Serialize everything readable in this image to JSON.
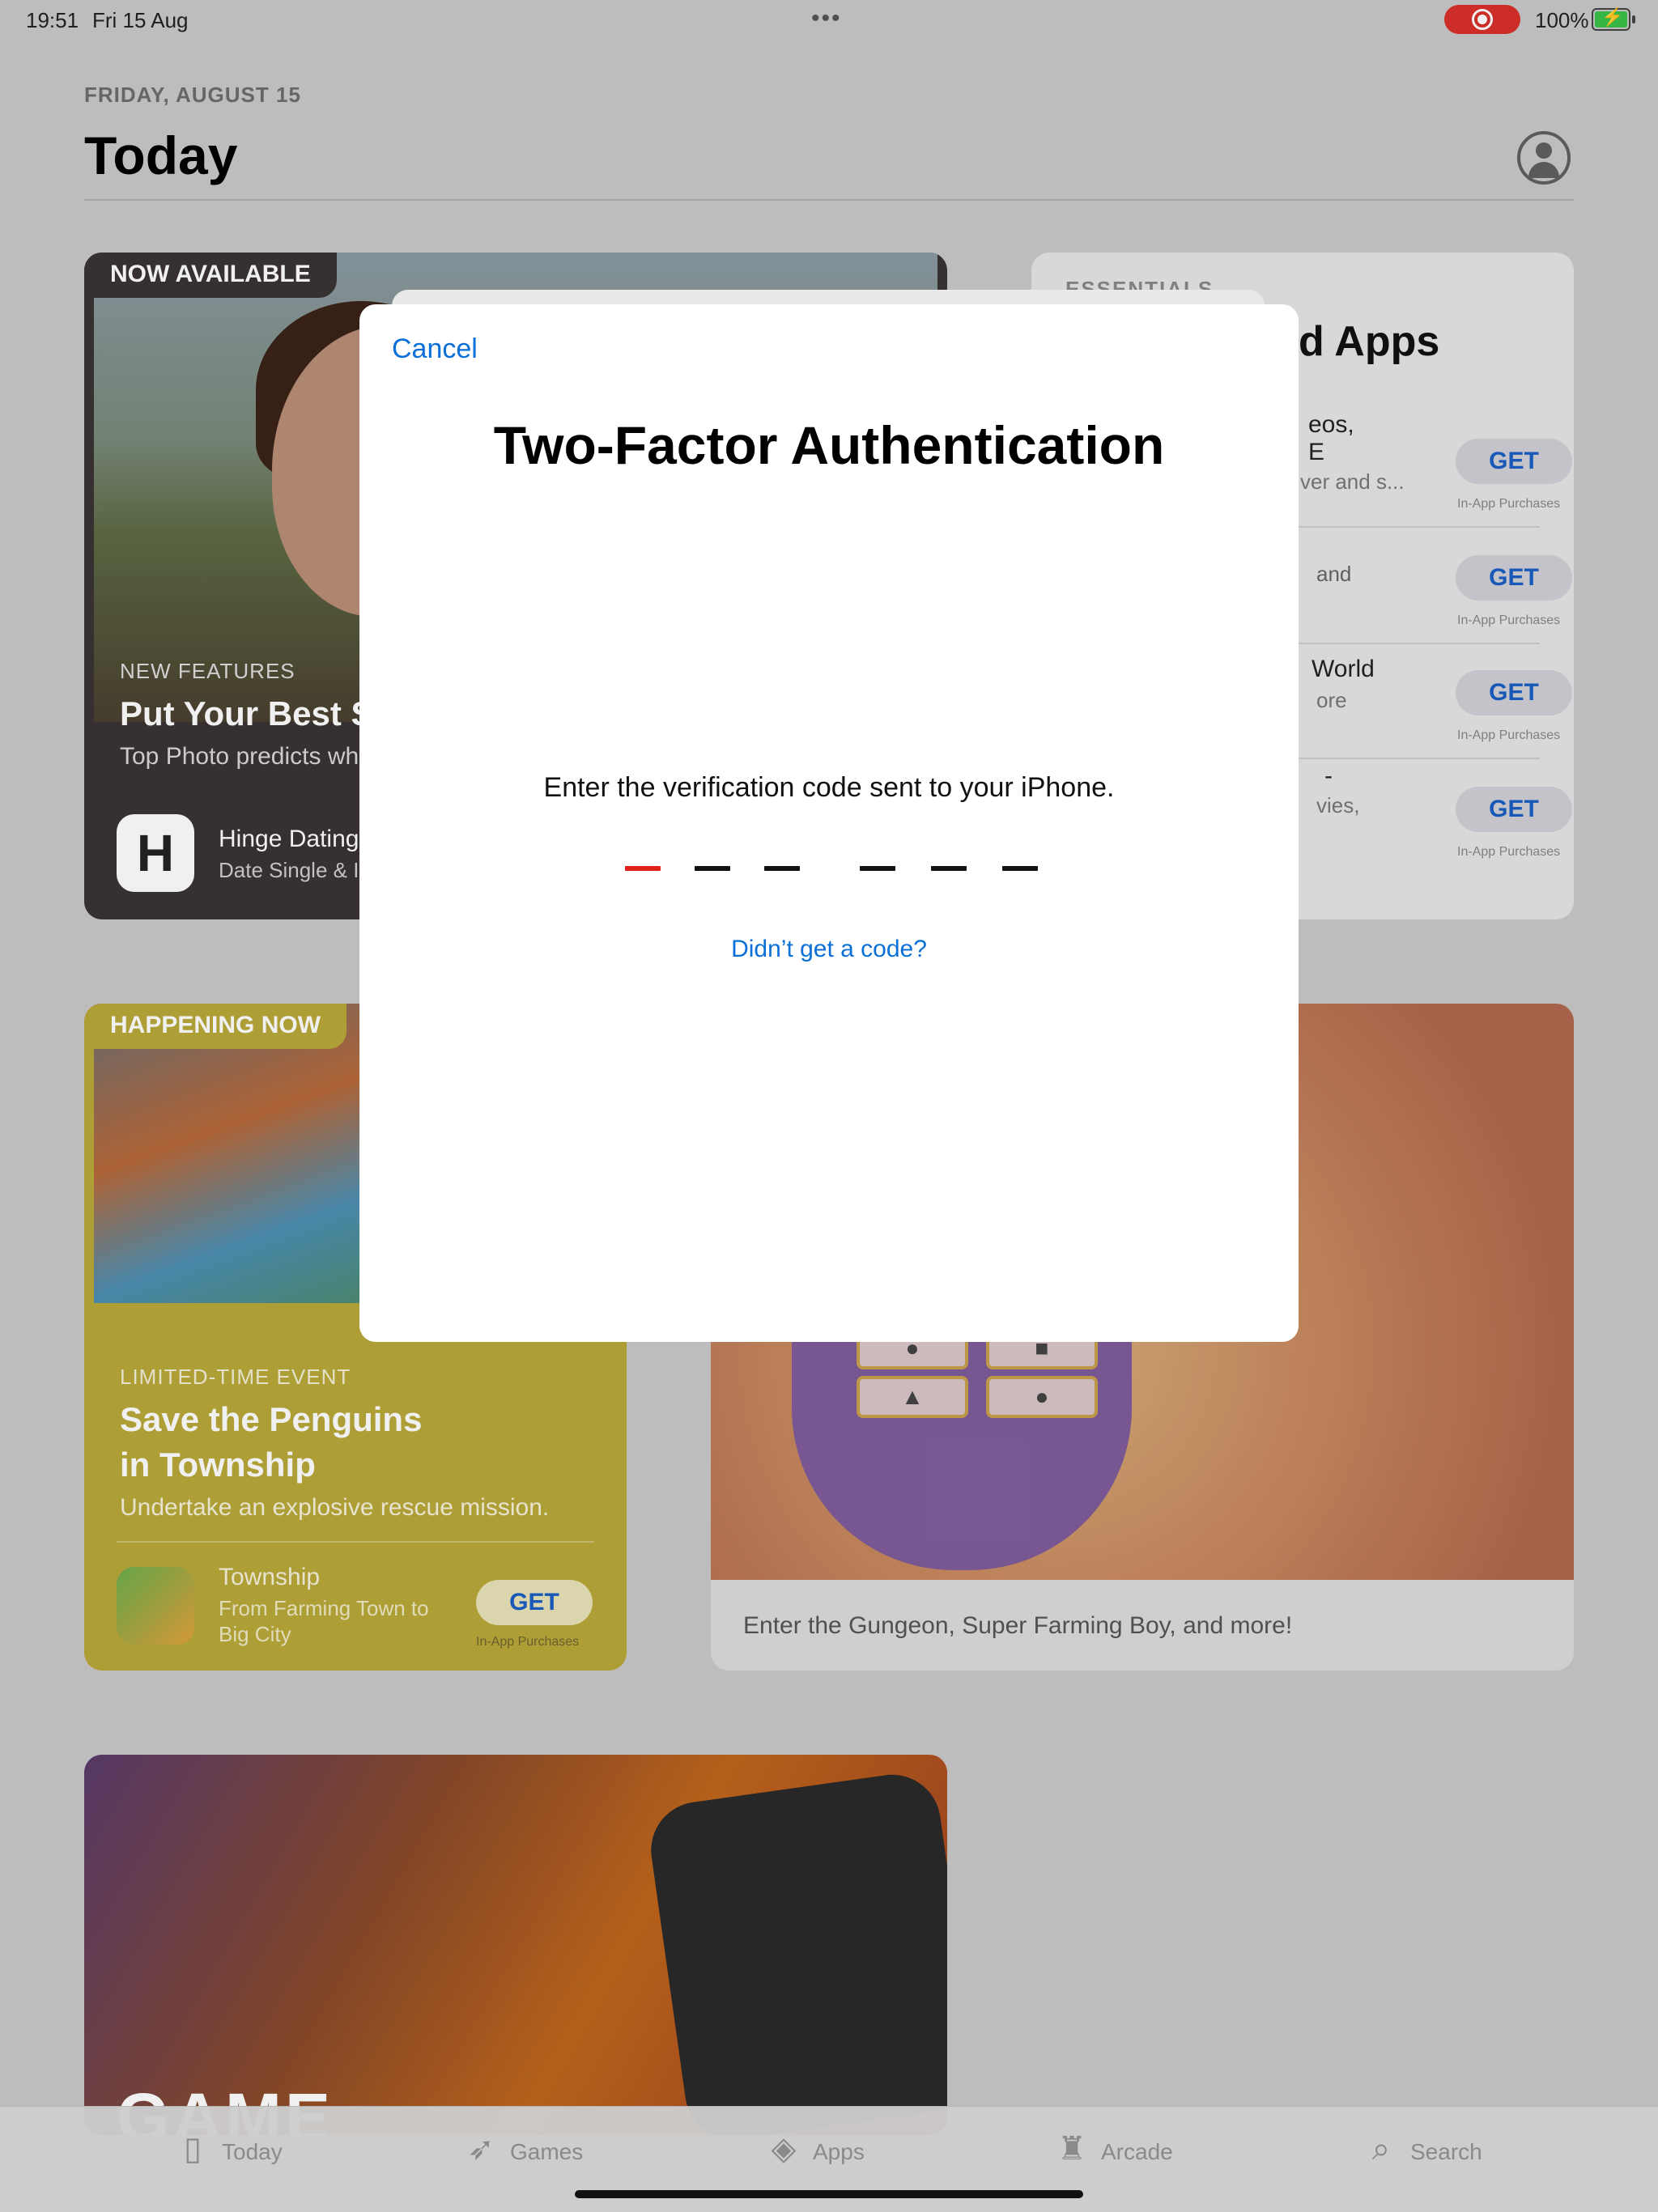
{
  "status_bar": {
    "time": "19:51",
    "date": "Fri 15 Aug",
    "battery_percent": "100%",
    "recording": true
  },
  "header": {
    "date": "FRIDAY, AUGUST 15",
    "title": "Today"
  },
  "cards": {
    "now_available": {
      "tag": "NOW AVAILABLE",
      "kicker": "NEW FEATURES",
      "title": "Put Your Best S",
      "subtitle": "Top Photo predicts wh",
      "app_name": "Hinge Dating",
      "app_desc": "Date Single & I",
      "icon_letter": "H"
    },
    "essentials": {
      "kicker": "ESSENTIALS",
      "title": "d Apps",
      "rows": [
        {
          "line1": "eos,",
          "line2": "ver and s...",
          "line0": "E",
          "get": "GET",
          "iap": "In-App Purchases"
        },
        {
          "line1": "",
          "line2": "and",
          "get": "GET",
          "iap": "In-App Purchases"
        },
        {
          "line1": "World",
          "line2": "ore",
          "get": "GET",
          "iap": "In-App Purchases"
        },
        {
          "line1": "-",
          "line2": "vies,",
          "get": "GET",
          "iap": "In-App Purchases"
        }
      ]
    },
    "happening_now": {
      "tag": "HAPPENING NOW",
      "kicker": "LIMITED-TIME EVENT",
      "title_line1": "Save the Penguins",
      "title_line2": "in Township",
      "subtitle": "Undertake an explosive rescue mission.",
      "app_name": "Township",
      "app_desc_line1": "From Farming Town to",
      "app_desc_line2": "Big City",
      "get": "GET",
      "iap": "In-App Purchases"
    },
    "gungeon": {
      "caption": "Enter the Gungeon, Super Farming Boy, and more!"
    },
    "game_card": {
      "label": "GAME"
    }
  },
  "tab_bar": {
    "tabs": [
      {
        "label": "Today",
        "icon": "today-icon"
      },
      {
        "label": "Games",
        "icon": "rocket-icon"
      },
      {
        "label": "Apps",
        "icon": "stack-icon"
      },
      {
        "label": "Arcade",
        "icon": "joystick-icon"
      },
      {
        "label": "Search",
        "icon": "search-icon"
      }
    ]
  },
  "two_factor": {
    "cancel": "Cancel",
    "title": "Two-Factor Authentication",
    "prompt": "Enter the verification code sent to your iPhone.",
    "code_length": 6,
    "active_digit": 1,
    "resend": "Didn’t get a code?"
  },
  "colors": {
    "accent": "#0a6fd6",
    "active_digit": "#e0201b",
    "record": "#d9302c"
  }
}
